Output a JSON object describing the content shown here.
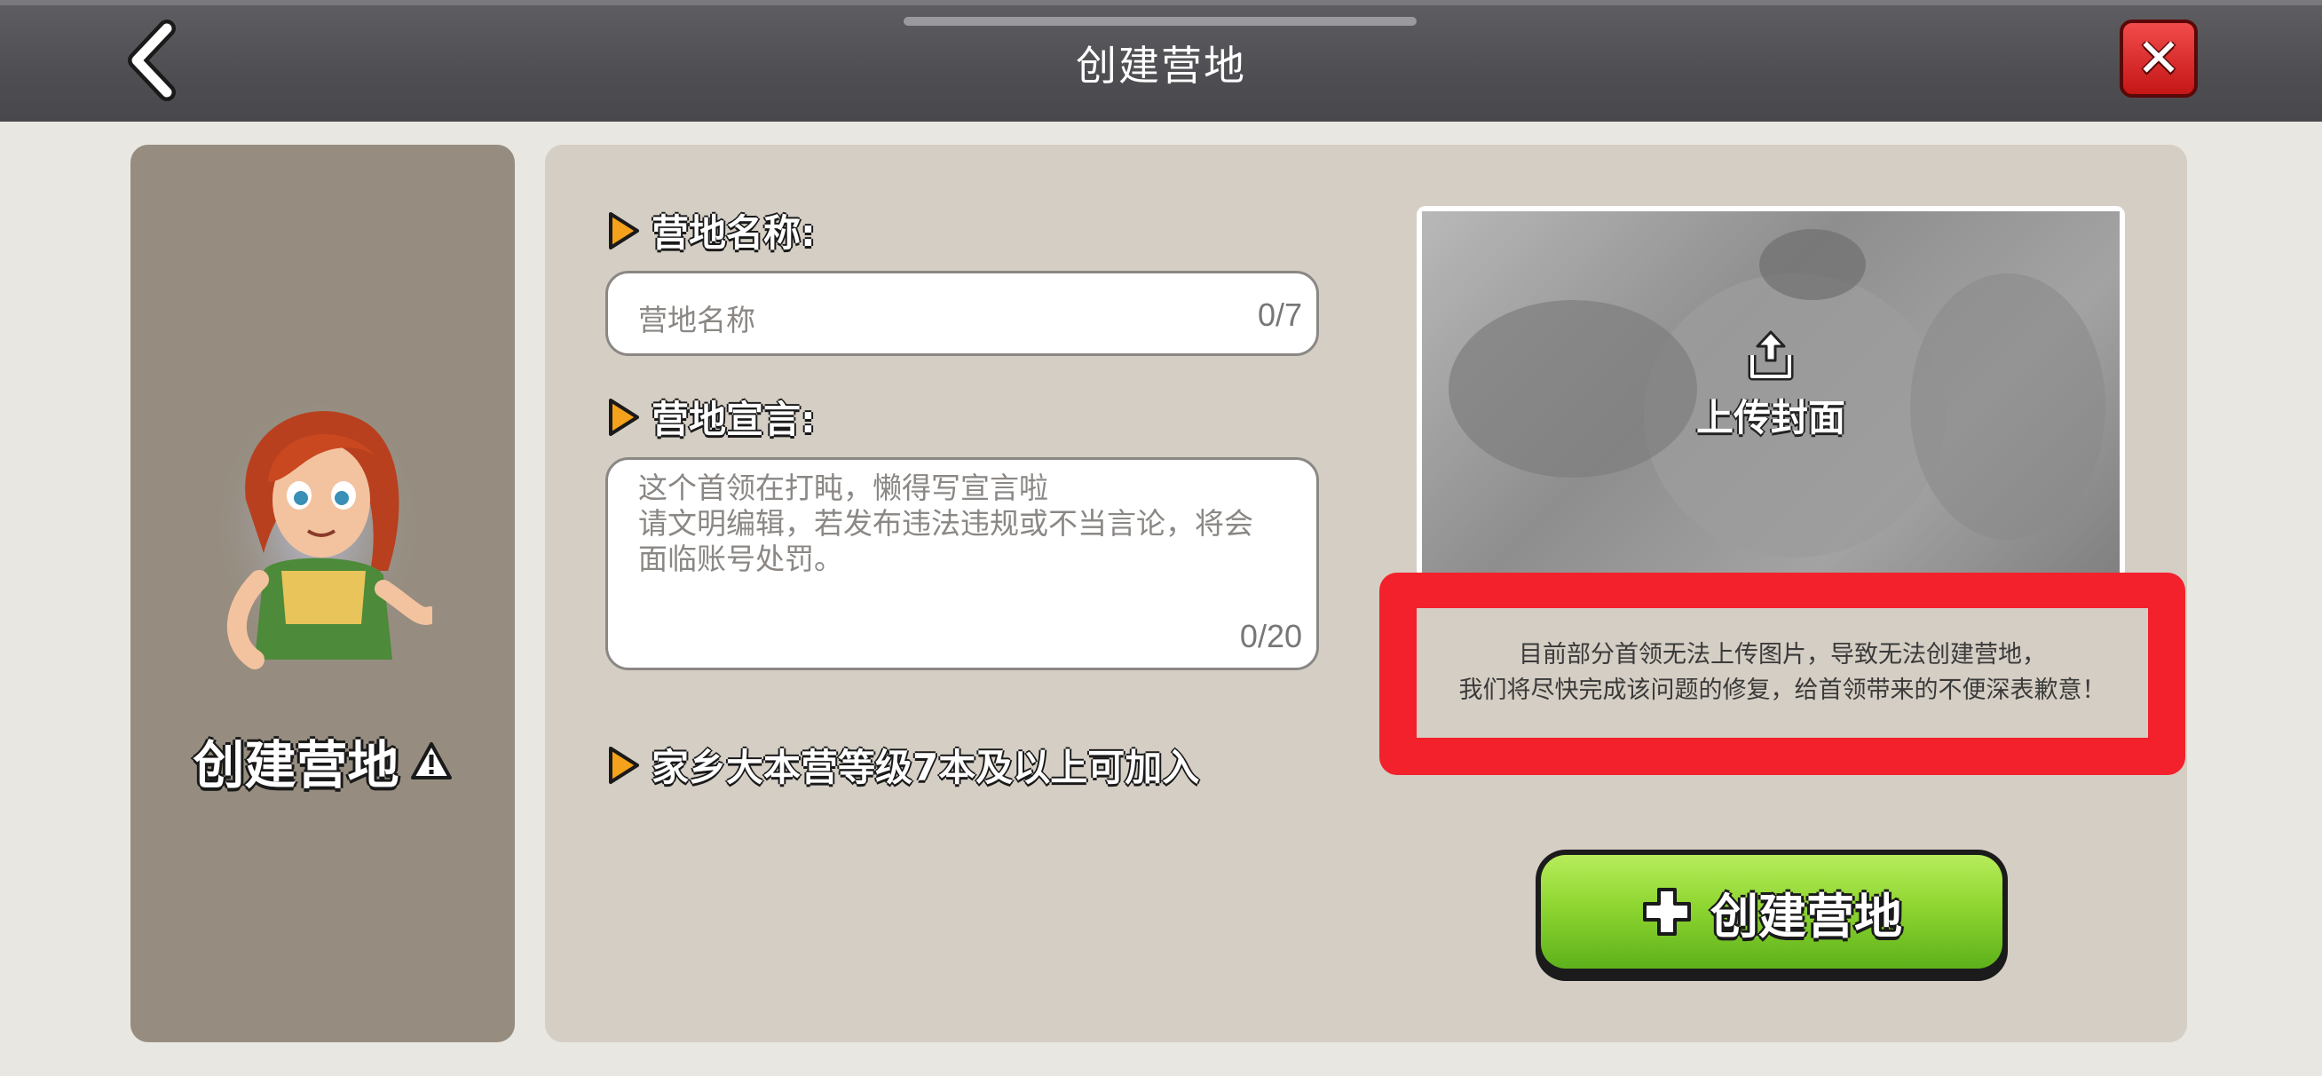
{
  "header": {
    "title": "创建营地"
  },
  "left_panel": {
    "title": "创建营地",
    "warning_icon": "warning-triangle-icon",
    "avatar_icon": "villager-avatar"
  },
  "form": {
    "name": {
      "label": "营地名称:",
      "placeholder": "营地名称",
      "count": "0/7"
    },
    "declaration": {
      "label": "营地宣言:",
      "placeholder_lines": [
        "这个首领在打盹，懒得写宣言啦",
        "请文明编辑，若发布违法违规或不当言论，将会",
        "面临账号处罚。"
      ],
      "count": "0/20"
    },
    "requirement": {
      "label": "家乡大本营等级7本及以上可加入"
    }
  },
  "upload": {
    "label": "上传封面",
    "icon": "upload-icon"
  },
  "notice": {
    "lines": [
      "目前部分首领无法上传图片，导致无法创建营地，",
      "我们将尽快完成该问题的修复，给首领带来的不便深表歉意！"
    ],
    "frame_color": "#f2212c"
  },
  "create_button": {
    "label": "创建营地",
    "icon": "plus-icon"
  },
  "colors": {
    "header": "#4f4f53",
    "left_panel": "#968d80",
    "main_panel": "#d5cec4",
    "close_button": "#d62020",
    "create_button": "#8fd631"
  }
}
